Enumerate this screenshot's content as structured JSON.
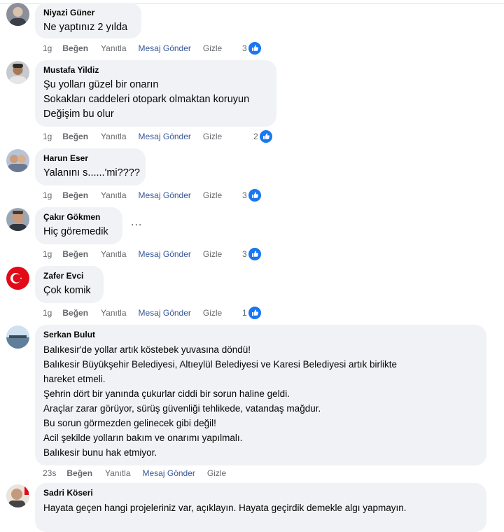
{
  "colors": {
    "bubble_bg": "#f0f2f5",
    "meta_text": "#65676b",
    "link_blue": "#385898",
    "like_blue": "#1877f2"
  },
  "comments": [
    {
      "author": "Niyazi Güner",
      "lines": [
        "Ne yaptınız 2 yılda"
      ],
      "time": "1g",
      "like": "Beğen",
      "reply": "Yanıtla",
      "message": "Mesaj Gönder",
      "hide": "Gizle",
      "reactions": "3",
      "reaction_icon": "like-icon"
    },
    {
      "author": "Mustafa Yildiz",
      "lines": [
        "Şu yolları güzel bir onarın",
        "Sokakları caddeleri otopark olmaktan koruyun",
        "Değişim bu olur"
      ],
      "time": "1g",
      "like": "Beğen",
      "reply": "Yanıtla",
      "message": "Mesaj Gönder",
      "hide": "Gizle",
      "reactions": "2",
      "reaction_icon": "like-icon"
    },
    {
      "author": "Harun Eser",
      "lines": [
        "Yalanını s......'mi????"
      ],
      "time": "1g",
      "like": "Beğen",
      "reply": "Yanıtla",
      "message": "Mesaj Gönder",
      "hide": "Gizle",
      "reactions": "3",
      "reaction_icon": "like-icon"
    },
    {
      "author": "Çakır Gökmen",
      "lines": [
        "Hiç göremedik"
      ],
      "more": "...",
      "time": "1g",
      "like": "Beğen",
      "reply": "Yanıtla",
      "message": "Mesaj Gönder",
      "hide": "Gizle",
      "reactions": "3",
      "reaction_icon": "like-icon"
    },
    {
      "author": "Zafer Evci",
      "lines": [
        "Çok komik"
      ],
      "time": "1g",
      "like": "Beğen",
      "reply": "Yanıtla",
      "message": "Mesaj Gönder",
      "hide": "Gizle",
      "reactions": "1",
      "reaction_icon": "like-icon"
    },
    {
      "author": "Serkan Bulut",
      "lines": [
        "Balıkesir'de yollar artık köstebek yuvasına döndü!",
        "Balıkesir Büyükşehir Belediyesi, Altıeylül Belediyesi ve Karesi Belediyesi artık birlikte",
        "hareket etmeli.",
        "Şehrin dört bir yanında çukurlar ciddi bir sorun haline geldi.",
        "Araçlar zarar görüyor, sürüş güvenliği tehlikede, vatandaş mağdur.",
        "Bu sorun görmezden gelinecek gibi değil!",
        "Acil şekilde yolların bakım ve onarımı yapılmalı.",
        "Balıkesir bunu hak etmiyor."
      ],
      "time": "23s",
      "like": "Beğen",
      "reply": "Yanıtla",
      "message": "Mesaj Gönder",
      "hide": "Gizle"
    },
    {
      "author": "Sadri Köseri",
      "lines": [
        "Hayata geçen hangi projeleriniz var, açıklayın. Hayata geçirdik demekle algı yapmayın."
      ]
    }
  ]
}
